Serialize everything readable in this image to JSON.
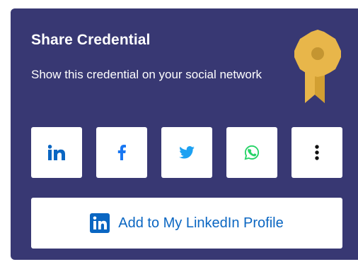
{
  "card": {
    "title": "Share Credential",
    "subtitle": "Show this credential on your social network"
  },
  "share_buttons": [
    {
      "name": "linkedin",
      "icon": "linkedin-icon",
      "color": "#0a66c2"
    },
    {
      "name": "facebook",
      "icon": "facebook-icon",
      "color": "#1877f2"
    },
    {
      "name": "twitter",
      "icon": "twitter-icon",
      "color": "#1da1f2"
    },
    {
      "name": "whatsapp",
      "icon": "whatsapp-icon",
      "color": "#25d366"
    },
    {
      "name": "more",
      "icon": "more-vertical-icon",
      "color": "#111111"
    }
  ],
  "linkedin_profile_button": {
    "label": "Add to My LinkedIn Profile",
    "icon": "linkedin-logo-icon",
    "color": "#0a66c2"
  },
  "colors": {
    "card_background": "#383873",
    "badge_gold": "#e8b64a"
  }
}
